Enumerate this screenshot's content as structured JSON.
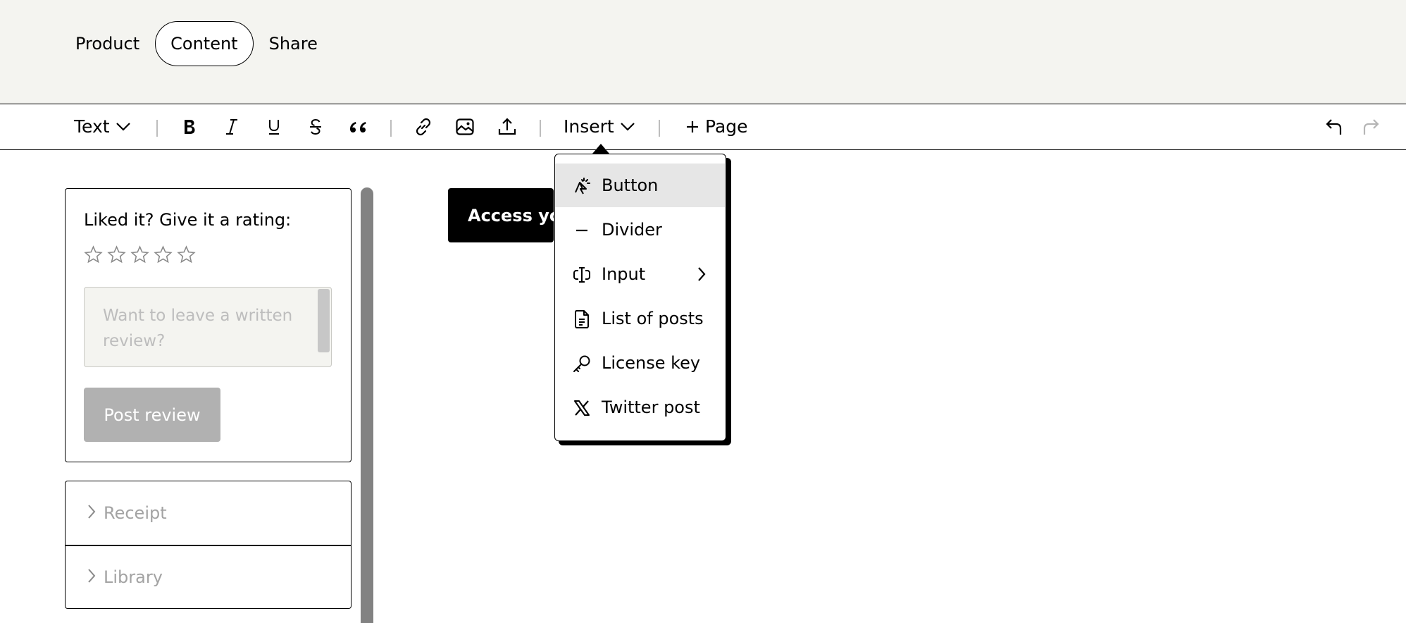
{
  "tabs": [
    {
      "label": "Product",
      "active": false
    },
    {
      "label": "Content",
      "active": true
    },
    {
      "label": "Share",
      "active": false
    }
  ],
  "toolbar": {
    "text_style": "Text",
    "insert": "Insert",
    "add_page": "Page",
    "icons": [
      "bold-icon",
      "italic-icon",
      "underline-icon",
      "strikethrough-icon",
      "quote-icon",
      "link-icon",
      "image-icon",
      "upload-icon",
      "undo-icon",
      "redo-icon"
    ]
  },
  "insert_menu": {
    "items": [
      {
        "label": "Button",
        "icon": "sparkle-cursor-icon",
        "highlighted": true
      },
      {
        "label": "Divider",
        "icon": "minus-icon"
      },
      {
        "label": "Input",
        "icon": "text-cursor-icon",
        "has_submenu": true
      },
      {
        "label": "List of posts",
        "icon": "file-text-icon"
      },
      {
        "label": "License key",
        "icon": "key-icon"
      },
      {
        "label": "Twitter post",
        "icon": "x-logo-icon"
      }
    ]
  },
  "rating_card": {
    "title": "Liked it? Give it a rating:",
    "stars_total": 5,
    "stars_filled": 0,
    "review_placeholder": "Want to leave a written review?",
    "post_button": "Post review"
  },
  "accordion": {
    "items": [
      {
        "label": "Receipt"
      },
      {
        "label": "Library"
      }
    ]
  },
  "canvas": {
    "access_button": "Access your"
  },
  "colors": {
    "header_bg": "#f4f4f0",
    "highlight": "#e6e6e6",
    "disabled_button": "#b1b1b1",
    "muted_text": "#a3a3a3"
  }
}
